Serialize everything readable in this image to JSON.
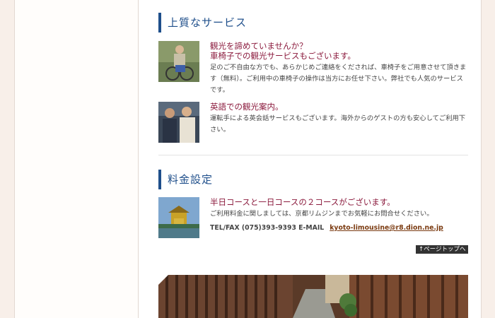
{
  "sections": {
    "service": {
      "title": "上質なサービス",
      "items": [
        {
          "headline": "観光を諦めていませんか？\n車椅子での観光サービスもございます。",
          "body": "足のご不自由な方でも、あらかじめご連絡をくだされば、車椅子をご用意させて頂きます（無料）。ご利用中の車椅子の操作は当方にお任せ下さい。弊社でも人気のサービスです。"
        },
        {
          "headline": "英語での観光案内。",
          "body": "運転手による英会話サービスもございます。海外からのゲストの方も安心してご利用下さい。"
        }
      ]
    },
    "pricing": {
      "title": "料金設定",
      "headline": "半日コースと一日コースの２コースがございます。",
      "body": "ご利用料金に関しましては、京都リムジンまでお気軽にお問合せください。",
      "contact_prefix": "TEL/FAX (075)393-9393 E-MAIL",
      "email": "kyoto-limousine@r8.dion.ne.jp"
    }
  },
  "page_top_label": "↑ページトップへ",
  "colors": {
    "accent_blue": "#1f4f8b",
    "headline_red": "#8b1a3d"
  }
}
